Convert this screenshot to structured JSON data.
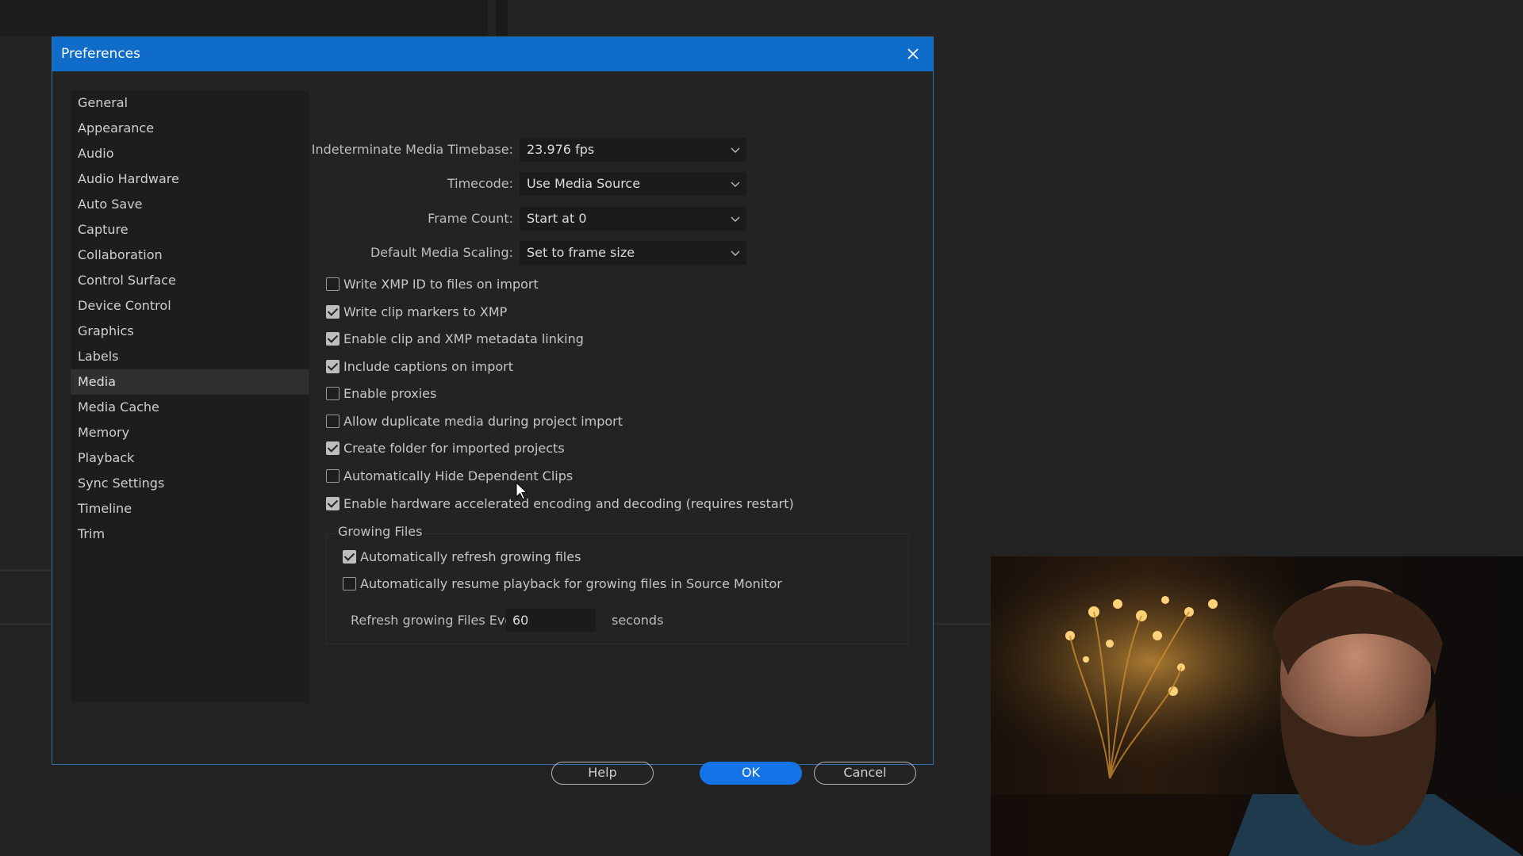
{
  "dialog": {
    "title": "Preferences"
  },
  "sidebar": {
    "items": [
      {
        "label": "General"
      },
      {
        "label": "Appearance"
      },
      {
        "label": "Audio"
      },
      {
        "label": "Audio Hardware"
      },
      {
        "label": "Auto Save"
      },
      {
        "label": "Capture"
      },
      {
        "label": "Collaboration"
      },
      {
        "label": "Control Surface"
      },
      {
        "label": "Device Control"
      },
      {
        "label": "Graphics"
      },
      {
        "label": "Labels"
      },
      {
        "label": "Media"
      },
      {
        "label": "Media Cache"
      },
      {
        "label": "Memory"
      },
      {
        "label": "Playback"
      },
      {
        "label": "Sync Settings"
      },
      {
        "label": "Timeline"
      },
      {
        "label": "Trim"
      }
    ],
    "selected": "Media"
  },
  "settings": {
    "media_timebase": {
      "label": "Indeterminate Media Timebase:",
      "value": "23.976 fps"
    },
    "timecode": {
      "label": "Timecode:",
      "value": "Use Media Source"
    },
    "frame_count": {
      "label": "Frame Count:",
      "value": "Start at 0"
    },
    "media_scaling": {
      "label": "Default Media Scaling:",
      "value": "Set to frame size"
    }
  },
  "checkboxes": [
    {
      "label": "Write XMP ID to files on import",
      "checked": false
    },
    {
      "label": "Write clip markers to XMP",
      "checked": true
    },
    {
      "label": "Enable clip and XMP metadata linking",
      "checked": true
    },
    {
      "label": "Include captions on import",
      "checked": true
    },
    {
      "label": "Enable proxies",
      "checked": false
    },
    {
      "label": "Allow duplicate media during project import",
      "checked": false
    },
    {
      "label": "Create folder for imported projects",
      "checked": true
    },
    {
      "label": "Automatically Hide Dependent Clips",
      "checked": false
    },
    {
      "label": "Enable hardware accelerated encoding and decoding (requires restart)",
      "checked": true
    }
  ],
  "growing_files": {
    "title": "Growing Files",
    "checkboxes": [
      {
        "label": "Automatically refresh growing files",
        "checked": true
      },
      {
        "label": "Automatically resume playback for growing files in Source Monitor",
        "checked": false
      }
    ],
    "refresh_label": "Refresh growing Files Every",
    "refresh_value": "60",
    "unit": "seconds"
  },
  "buttons": {
    "help": "Help",
    "ok": "OK",
    "cancel": "Cancel"
  },
  "colors": {
    "titlebar": "#0f6cc9",
    "primary": "#1473e6",
    "background": "#232323"
  }
}
